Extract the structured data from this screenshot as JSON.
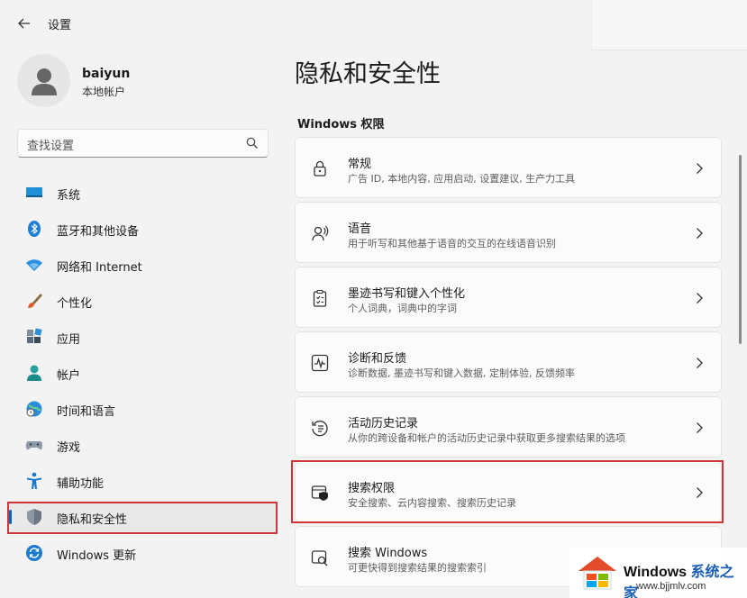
{
  "window": {
    "title": "设置",
    "back_icon": "back-arrow-icon"
  },
  "profile": {
    "username": "baiyun",
    "account_type": "本地帐户"
  },
  "search": {
    "placeholder": "查找设置"
  },
  "nav": {
    "items": [
      {
        "label": "系统",
        "icon": "system-icon"
      },
      {
        "label": "蓝牙和其他设备",
        "icon": "bluetooth-icon"
      },
      {
        "label": "网络和 Internet",
        "icon": "network-icon"
      },
      {
        "label": "个性化",
        "icon": "personalization-icon"
      },
      {
        "label": "应用",
        "icon": "apps-icon"
      },
      {
        "label": "帐户",
        "icon": "account-icon"
      },
      {
        "label": "时间和语言",
        "icon": "time-language-icon"
      },
      {
        "label": "游戏",
        "icon": "gaming-icon"
      },
      {
        "label": "辅助功能",
        "icon": "accessibility-icon"
      },
      {
        "label": "隐私和安全性",
        "icon": "privacy-shield-icon",
        "selected": true
      },
      {
        "label": "Windows 更新",
        "icon": "windows-update-icon"
      }
    ]
  },
  "main": {
    "title": "隐私和安全性",
    "section": "Windows 权限",
    "cards": [
      {
        "title": "常规",
        "desc": "广告 ID, 本地内容, 应用启动, 设置建议, 生产力工具",
        "icon": "lock-icon"
      },
      {
        "title": "语音",
        "desc": "用于听写和其他基于语音的交互的在线语音识别",
        "icon": "speech-icon"
      },
      {
        "title": "墨迹书写和键入个性化",
        "desc": "个人词典，词典中的字词",
        "icon": "inking-clipboard-icon"
      },
      {
        "title": "诊断和反馈",
        "desc": "诊断数据, 墨迹书写和键入数据, 定制体验, 反馈频率",
        "icon": "diagnostics-icon"
      },
      {
        "title": "活动历史记录",
        "desc": "从你的跨设备和帐户的活动历史记录中获取更多搜索结果的选项",
        "icon": "activity-history-icon"
      },
      {
        "title": "搜索权限",
        "desc": "安全搜索、云内容搜索、搜索历史记录",
        "icon": "search-permissions-icon"
      },
      {
        "title": "搜索 Windows",
        "desc": "可更快得到搜索结果的搜索索引",
        "icon": "search-windows-icon"
      }
    ]
  },
  "watermark": {
    "brand": "Windows",
    "brand_cn": "系统之家",
    "url": "www.bjjmlv.com"
  },
  "colors": {
    "accent": "#0067c0",
    "highlight": "#d2343a"
  }
}
